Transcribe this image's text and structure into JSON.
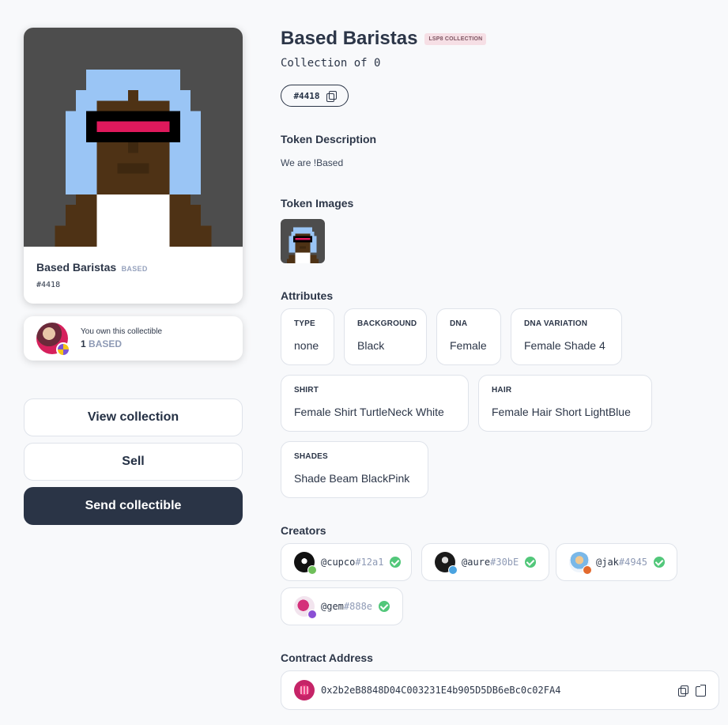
{
  "nft": {
    "name": "Based Baristas",
    "symbol": "BASED",
    "token_id": "#4418",
    "image_bg": "#4d4d4d"
  },
  "ownership": {
    "label": "You own this collectible",
    "amount": "1",
    "symbol": "BASED"
  },
  "buttons": {
    "view_collection": "View collection",
    "sell": "Sell",
    "send": "Send collectible"
  },
  "header": {
    "title": "Based Baristas",
    "badge": "LSP8 COLLECTION",
    "collection_of": "Collection of 0",
    "token_pill": "#4418"
  },
  "description": {
    "heading": "Token Description",
    "text": "We are !Based"
  },
  "images": {
    "heading": "Token Images"
  },
  "attributes": {
    "heading": "Attributes",
    "items": [
      {
        "key": "TYPE",
        "value": "none"
      },
      {
        "key": "BACKGROUND",
        "value": "Black"
      },
      {
        "key": "DNA",
        "value": "Female"
      },
      {
        "key": "DNA VARIATION",
        "value": "Female Shade 4"
      },
      {
        "key": "SHIRT",
        "value": "Female Shirt TurtleNeck White"
      },
      {
        "key": "HAIR",
        "value": "Female Hair Short LightBlue"
      },
      {
        "key": "SHADES",
        "value": "Shade Beam BlackPink"
      }
    ]
  },
  "creators": {
    "heading": "Creators",
    "items": [
      {
        "name": "@cupco",
        "hash": "#12a1"
      },
      {
        "name": "@aure",
        "hash": "#30bE"
      },
      {
        "name": "@jak",
        "hash": "#4945"
      },
      {
        "name": "@gem",
        "hash": "#888e"
      }
    ]
  },
  "contract": {
    "heading": "Contract Address",
    "address": "0x2b2eB8848D04C003231E4b905D5DB6eBc0c02FA4"
  },
  "colors": {
    "accent_dark": "#2a3446",
    "verified": "#52c77a",
    "badge_bg": "#f6dfe5"
  }
}
